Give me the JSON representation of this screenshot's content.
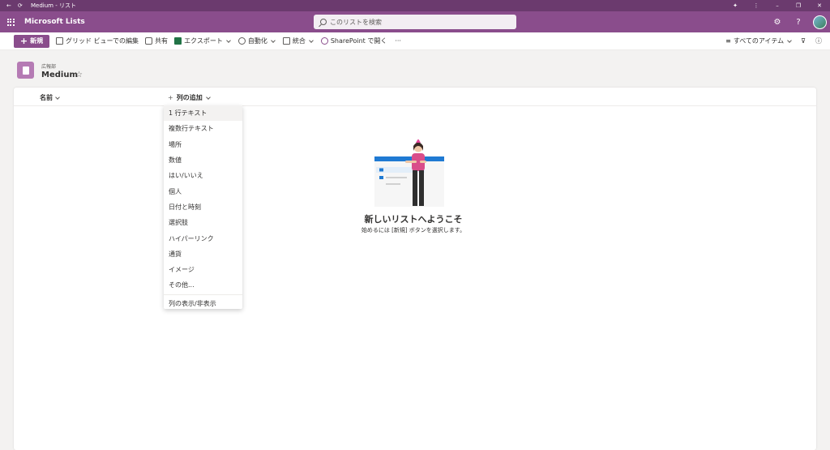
{
  "titlebar": {
    "title": "Medium - リスト"
  },
  "suite": {
    "app_name": "Microsoft Lists",
    "search_placeholder": "このリストを検索"
  },
  "commands": {
    "new": "新規",
    "grid_edit": "グリッド ビューでの編集",
    "share": "共有",
    "export": "エクスポート",
    "automate": "自動化",
    "integrate": "統合",
    "sharepoint": "SharePoint で開く",
    "more": "···",
    "view": "すべてのアイテム"
  },
  "list": {
    "site": "広報部",
    "title": "Medium",
    "star": "☆"
  },
  "columns": {
    "name": "名前",
    "add": "列の追加",
    "plus": "+"
  },
  "menu": {
    "items": [
      "1 行テキスト",
      "複数行テキスト",
      "場所",
      "数値",
      "はい/いいえ",
      "個人",
      "日付と時刻",
      "選択肢",
      "ハイパーリンク",
      "通貨",
      "イメージ",
      "その他..."
    ],
    "footer": "列の表示/非表示"
  },
  "empty": {
    "title": "新しいリストへようこそ",
    "subtitle": "始めるには [新規] ボタンを選択します。"
  },
  "colors": {
    "title_bar": "#6b3a6e",
    "suite_bar": "#8a4d8c",
    "accent": "#8a4d8c",
    "list_icon": "#b57bb4"
  }
}
